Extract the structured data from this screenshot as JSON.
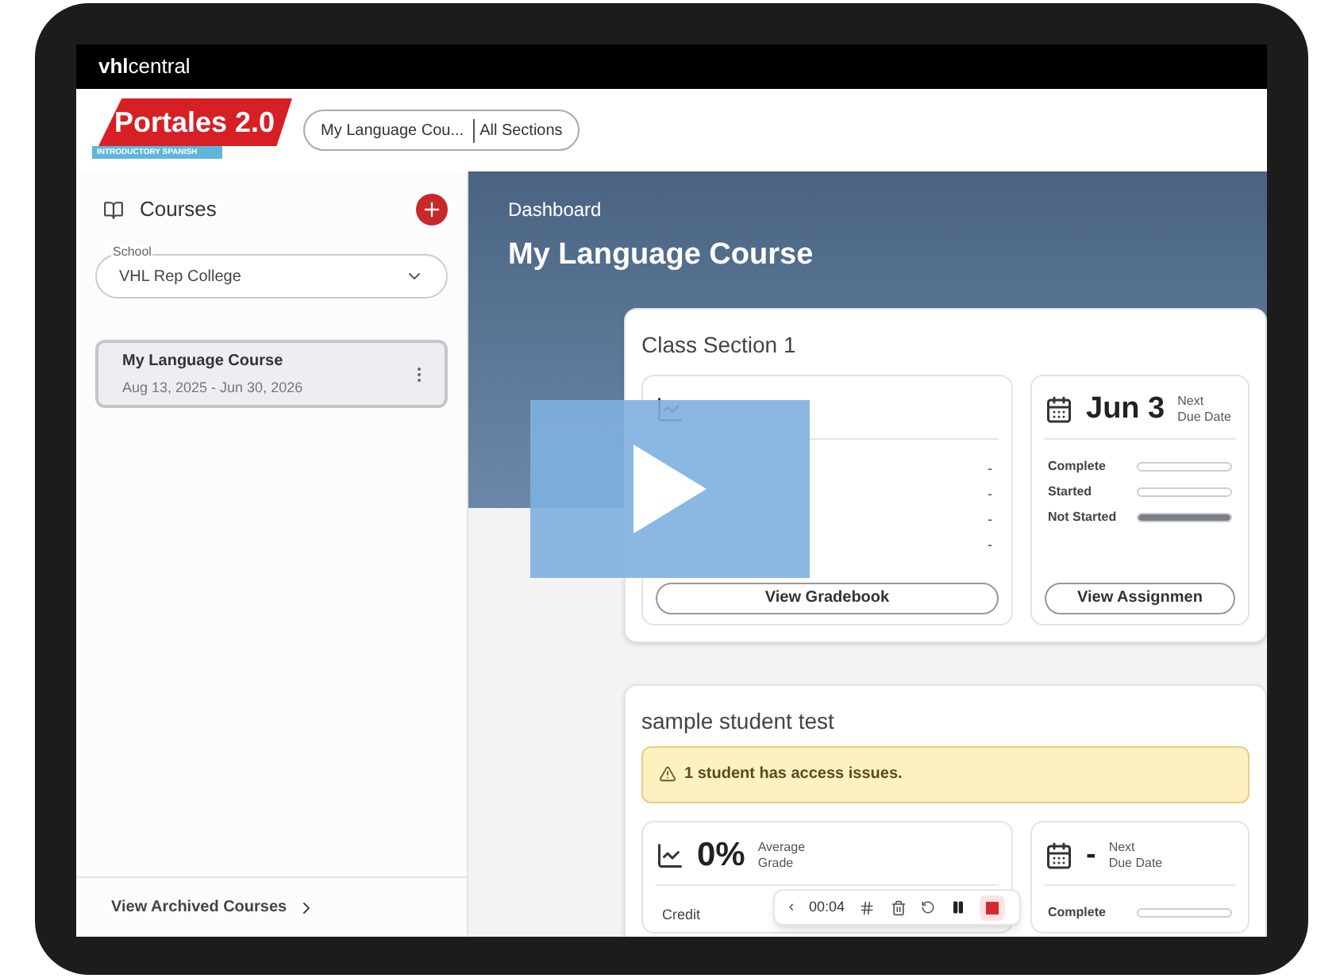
{
  "top_bar": {
    "brand_bold": "vhl",
    "brand_light": "central"
  },
  "header": {
    "logo": {
      "title": "Portales 2.0",
      "subtitle": "INTRODUCTORY SPANISH"
    },
    "course_selector": {
      "course": "My Language Cou...",
      "section": "All Sections"
    }
  },
  "sidebar": {
    "title": "Courses",
    "school_field": {
      "label": "School",
      "value": "VHL Rep College"
    },
    "courses": [
      {
        "name": "My Language Course",
        "dates": "Aug 13, 2025 - Jun 30, 2026",
        "selected": true
      }
    ],
    "footer_link": "View Archived Courses"
  },
  "main": {
    "breadcrumb": "Dashboard",
    "title": "My Language Course",
    "sections": [
      {
        "title": "Class Section 1",
        "grade": {
          "rows": [
            {
              "value": "-"
            },
            {
              "value": "-"
            },
            {
              "value": "-"
            },
            {
              "value": "-"
            }
          ],
          "button": "View Gradebook"
        },
        "due": {
          "value": "Jun 3",
          "labels": [
            "Next",
            "Due Date"
          ],
          "progress": [
            {
              "label": "Complete",
              "level": 0
            },
            {
              "label": "Started",
              "level": 0
            },
            {
              "label": "Not Started",
              "level": 1
            }
          ],
          "button": "View Assignmen"
        }
      },
      {
        "title": "sample student test",
        "alert": "1 student has access issues.",
        "grade": {
          "value": "0%",
          "labels": [
            "Average",
            "Grade"
          ],
          "rows": [
            {
              "label": "Credit"
            }
          ]
        },
        "due": {
          "value": "-",
          "labels": [
            "Next",
            "Due Date"
          ],
          "progress": [
            {
              "label": "Complete",
              "level": 0
            }
          ]
        }
      }
    ]
  },
  "recorder": {
    "back": "‹",
    "time": "00:04"
  }
}
